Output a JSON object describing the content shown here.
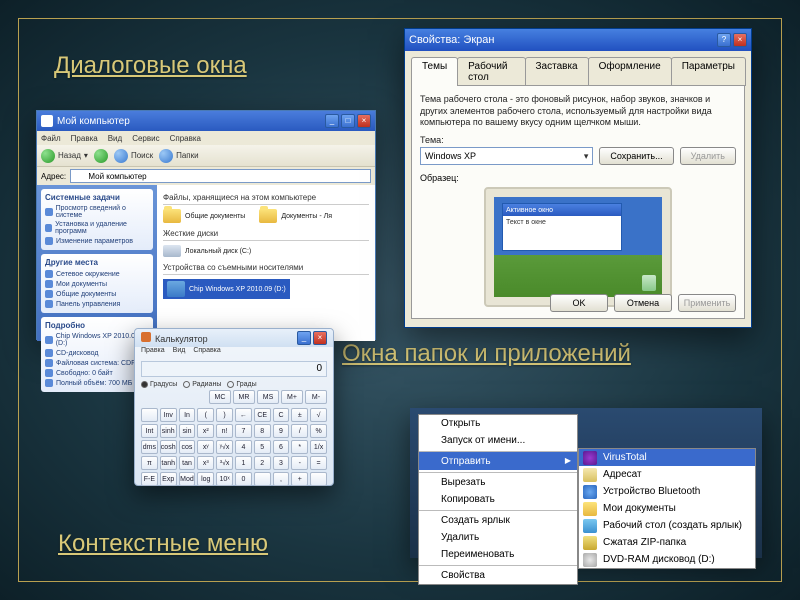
{
  "labels": {
    "dialogs": "Диалоговые окна",
    "folders": "Окна папок и приложений",
    "context": "Контекстные меню"
  },
  "explorer": {
    "title": "Мой компьютер",
    "menu": [
      "Файл",
      "Правка",
      "Вид",
      "Сервис",
      "Справка"
    ],
    "nav_back": "Назад",
    "nav_search": "Поиск",
    "nav_folders": "Папки",
    "address_label": "Адрес:",
    "address_value": "Мой компьютер",
    "side_groups": [
      {
        "title": "Системные задачи",
        "items": [
          "Просмотр сведений о системе",
          "Установка и удаление программ",
          "Изменение параметров"
        ]
      },
      {
        "title": "Другие места",
        "items": [
          "Сетевое окружение",
          "Мои документы",
          "Общие документы",
          "Панель управления"
        ]
      },
      {
        "title": "Подробно",
        "items": [
          "Chip Windows XP 2010.09 (D:)",
          "CD-дисковод",
          "Файловая система: CDFS",
          "Свободно: 0 байт",
          "Полный объём: 700 МБ"
        ]
      }
    ],
    "section_files": "Файлы, хранящиеся на этом компьютере",
    "files": [
      "Общие документы",
      "Документы - Ля"
    ],
    "section_drives": "Жесткие диски",
    "drives": [
      "Локальный диск (C:)"
    ],
    "section_removable": "Устройства со съемными носителями",
    "removable": [
      "Chip Windows XP 2010.09 (D:)"
    ],
    "status": "Свободно: 0 байт  Полный объём: 700 МБ"
  },
  "display": {
    "title": "Свойства: Экран",
    "tabs": [
      "Темы",
      "Рабочий стол",
      "Заставка",
      "Оформление",
      "Параметры"
    ],
    "desc": "Тема рабочего стола - это фоновый рисунок, набор звуков, значков и других элементов рабочего стола, используемый для настройки вида компьютера по вашему вкусу одним щелчком мыши.",
    "theme_label": "Тема:",
    "theme_value": "Windows XP",
    "btn_save": "Сохранить...",
    "btn_delete": "Удалить",
    "preview_label": "Образец:",
    "active_window_title": "Активное окно",
    "active_window_text": "Текст в окне",
    "ok": "OK",
    "cancel": "Отмена",
    "apply": "Применить"
  },
  "calc": {
    "title": "Калькулятор",
    "menu": [
      "Правка",
      "Вид",
      "Справка"
    ],
    "display": "0",
    "modes": [
      "Градусы",
      "Радианы",
      "Грады"
    ],
    "memrow": [
      "MC",
      "MR",
      "MS",
      "M+",
      "M-"
    ],
    "keys": [
      [
        "",
        "Inv",
        "In",
        "(",
        ")",
        "←",
        "CE",
        "C",
        "±",
        "√"
      ],
      [
        "Int",
        "sinh",
        "sin",
        "x²",
        "n!",
        "7",
        "8",
        "9",
        "/",
        "%"
      ],
      [
        "dms",
        "cosh",
        "cos",
        "xʸ",
        "ʸ√x",
        "4",
        "5",
        "6",
        "*",
        "1/x"
      ],
      [
        "π",
        "tanh",
        "tan",
        "x³",
        "³√x",
        "1",
        "2",
        "3",
        "-",
        "="
      ],
      [
        "F-E",
        "Exp",
        "Mod",
        "log",
        "10ˣ",
        "0",
        "",
        ",",
        "+",
        ""
      ]
    ]
  },
  "context": {
    "menu1": [
      {
        "t": "Открыть"
      },
      {
        "t": "Запуск от имени..."
      },
      {
        "t": "Отправить",
        "hl": true,
        "sub": true,
        "sep": true
      },
      {
        "t": "Вырезать",
        "sep": true
      },
      {
        "t": "Копировать"
      },
      {
        "t": "Создать ярлык",
        "sep": true
      },
      {
        "t": "Удалить"
      },
      {
        "t": "Переименовать"
      },
      {
        "t": "Свойства",
        "sep": true
      }
    ],
    "menu2": [
      {
        "t": "VirusTotal",
        "ico": "ico-vt",
        "hl": true
      },
      {
        "t": "Адресат",
        "ico": "ico-mail"
      },
      {
        "t": "Устройство Bluetooth",
        "ico": "ico-bt"
      },
      {
        "t": "Мои документы",
        "ico": "ico-docs"
      },
      {
        "t": "Рабочий стол (создать ярлык)",
        "ico": "ico-desk"
      },
      {
        "t": "Сжатая ZIP-папка",
        "ico": "ico-zip"
      },
      {
        "t": "DVD-RAM дисковод (D:)",
        "ico": "ico-dvd"
      }
    ]
  }
}
